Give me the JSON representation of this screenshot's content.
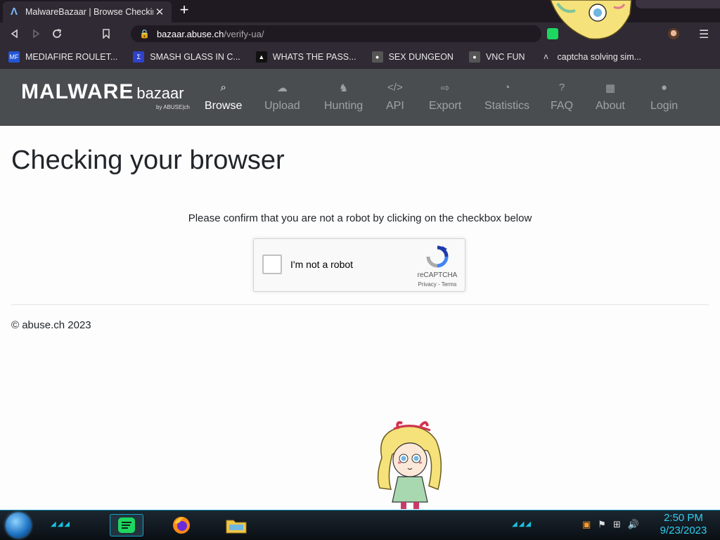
{
  "browser": {
    "tab": {
      "title": "MalwareBazaar | Browse Checking",
      "close": "✕"
    },
    "new_tab": "+",
    "url": {
      "host": "bazaar.abuse.ch",
      "path": "/verify-ua/"
    },
    "bookmarks": [
      {
        "label": "MEDIAFIRE ROULET...",
        "icon": "mediafire-icon",
        "color": "#2455d6",
        "badge": "MF"
      },
      {
        "label": "SMASH GLASS IN C...",
        "icon": "sigma-icon",
        "color": "#2f42c9",
        "badge": "Σ"
      },
      {
        "label": "WHATS THE PASS...",
        "icon": "site-icon",
        "color": "#111111",
        "badge": "▲"
      },
      {
        "label": "SEX DUNGEON",
        "icon": "github-icon",
        "color": "#555555",
        "badge": "●"
      },
      {
        "label": "VNC FUN",
        "icon": "github-icon",
        "color": "#555555",
        "badge": "●"
      },
      {
        "label": "captcha solving sim...",
        "icon": "lambda-icon",
        "color": "#2f2a33",
        "badge": "Λ"
      }
    ]
  },
  "site": {
    "brand": {
      "main": "MALWARE",
      "sub": "bazaar",
      "by": "by ABUSE|ch"
    },
    "nav": [
      {
        "label": "Browse",
        "icon": "search-icon",
        "glyph": "⌕",
        "active": true
      },
      {
        "label": "Upload",
        "icon": "cloud-upload-icon",
        "glyph": "☁",
        "active": false
      },
      {
        "label": "Hunting",
        "icon": "hunting-icon",
        "glyph": "♞",
        "active": false
      },
      {
        "label": "API",
        "icon": "code-icon",
        "glyph": "</>",
        "active": false
      },
      {
        "label": "Export",
        "icon": "export-icon",
        "glyph": "⇨",
        "active": false
      },
      {
        "label": "Statistics",
        "icon": "pie-chart-icon",
        "glyph": "◔",
        "active": false
      },
      {
        "label": "FAQ",
        "icon": "question-icon",
        "glyph": "?",
        "active": false
      },
      {
        "label": "About",
        "icon": "building-icon",
        "glyph": "▦",
        "active": false
      },
      {
        "label": "Login",
        "icon": "user-icon",
        "glyph": "●",
        "active": false
      }
    ],
    "heading": "Checking your browser",
    "instruction": "Please confirm that you are not a robot by clicking on the checkbox below",
    "recaptcha": {
      "label": "I'm not a robot",
      "brand": "reCAPTCHA",
      "links": "Privacy - Terms"
    },
    "footer": "© abuse.ch 2023"
  },
  "taskbar": {
    "apps": [
      {
        "name": "spotify",
        "icon": "spotify-icon",
        "active": true
      },
      {
        "name": "firefox",
        "icon": "firefox-icon",
        "active": false
      },
      {
        "name": "file-explorer",
        "icon": "folder-icon",
        "active": false
      }
    ],
    "clock": {
      "time": "2:50 PM",
      "date": "9/23/2023"
    }
  },
  "colors": {
    "nav_bg": "#4a4d50",
    "chrome_bg": "#2f2a33",
    "accent": "#17c2e0"
  }
}
